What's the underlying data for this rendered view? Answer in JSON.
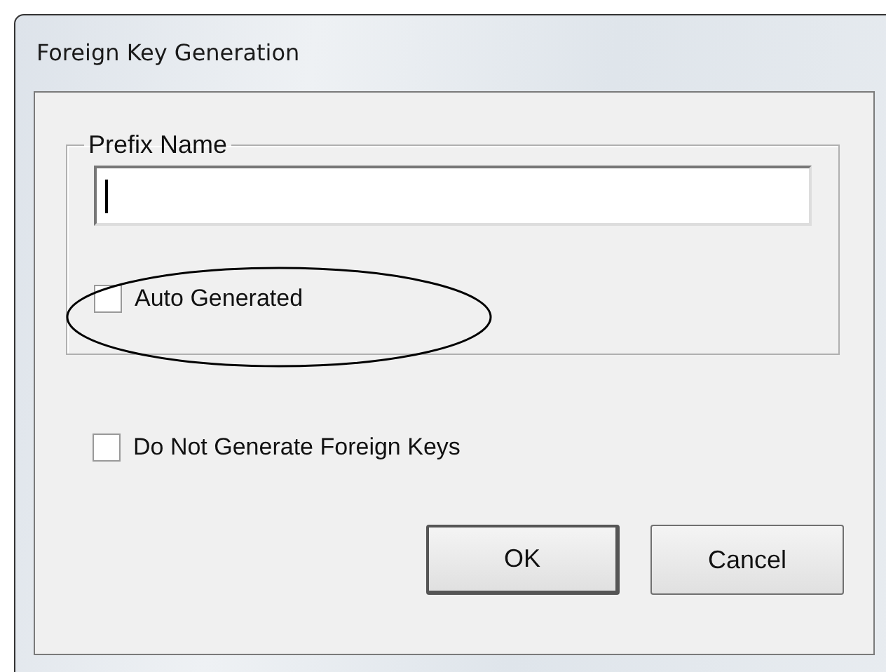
{
  "window": {
    "title": "Foreign Key Generation"
  },
  "prefix_group": {
    "label": "Prefix Name",
    "field": {
      "focused": true
    },
    "checkbox": {
      "label": "Auto Generated",
      "checked": false
    }
  },
  "annotation": {
    "kind": "ellipse"
  },
  "checkbox": {
    "label": "Do Not Generate Foreign Keys",
    "checked": false
  },
  "buttons": [
    {
      "label": "OK",
      "default": true
    },
    {
      "label": "Cancel",
      "default": false
    }
  ]
}
